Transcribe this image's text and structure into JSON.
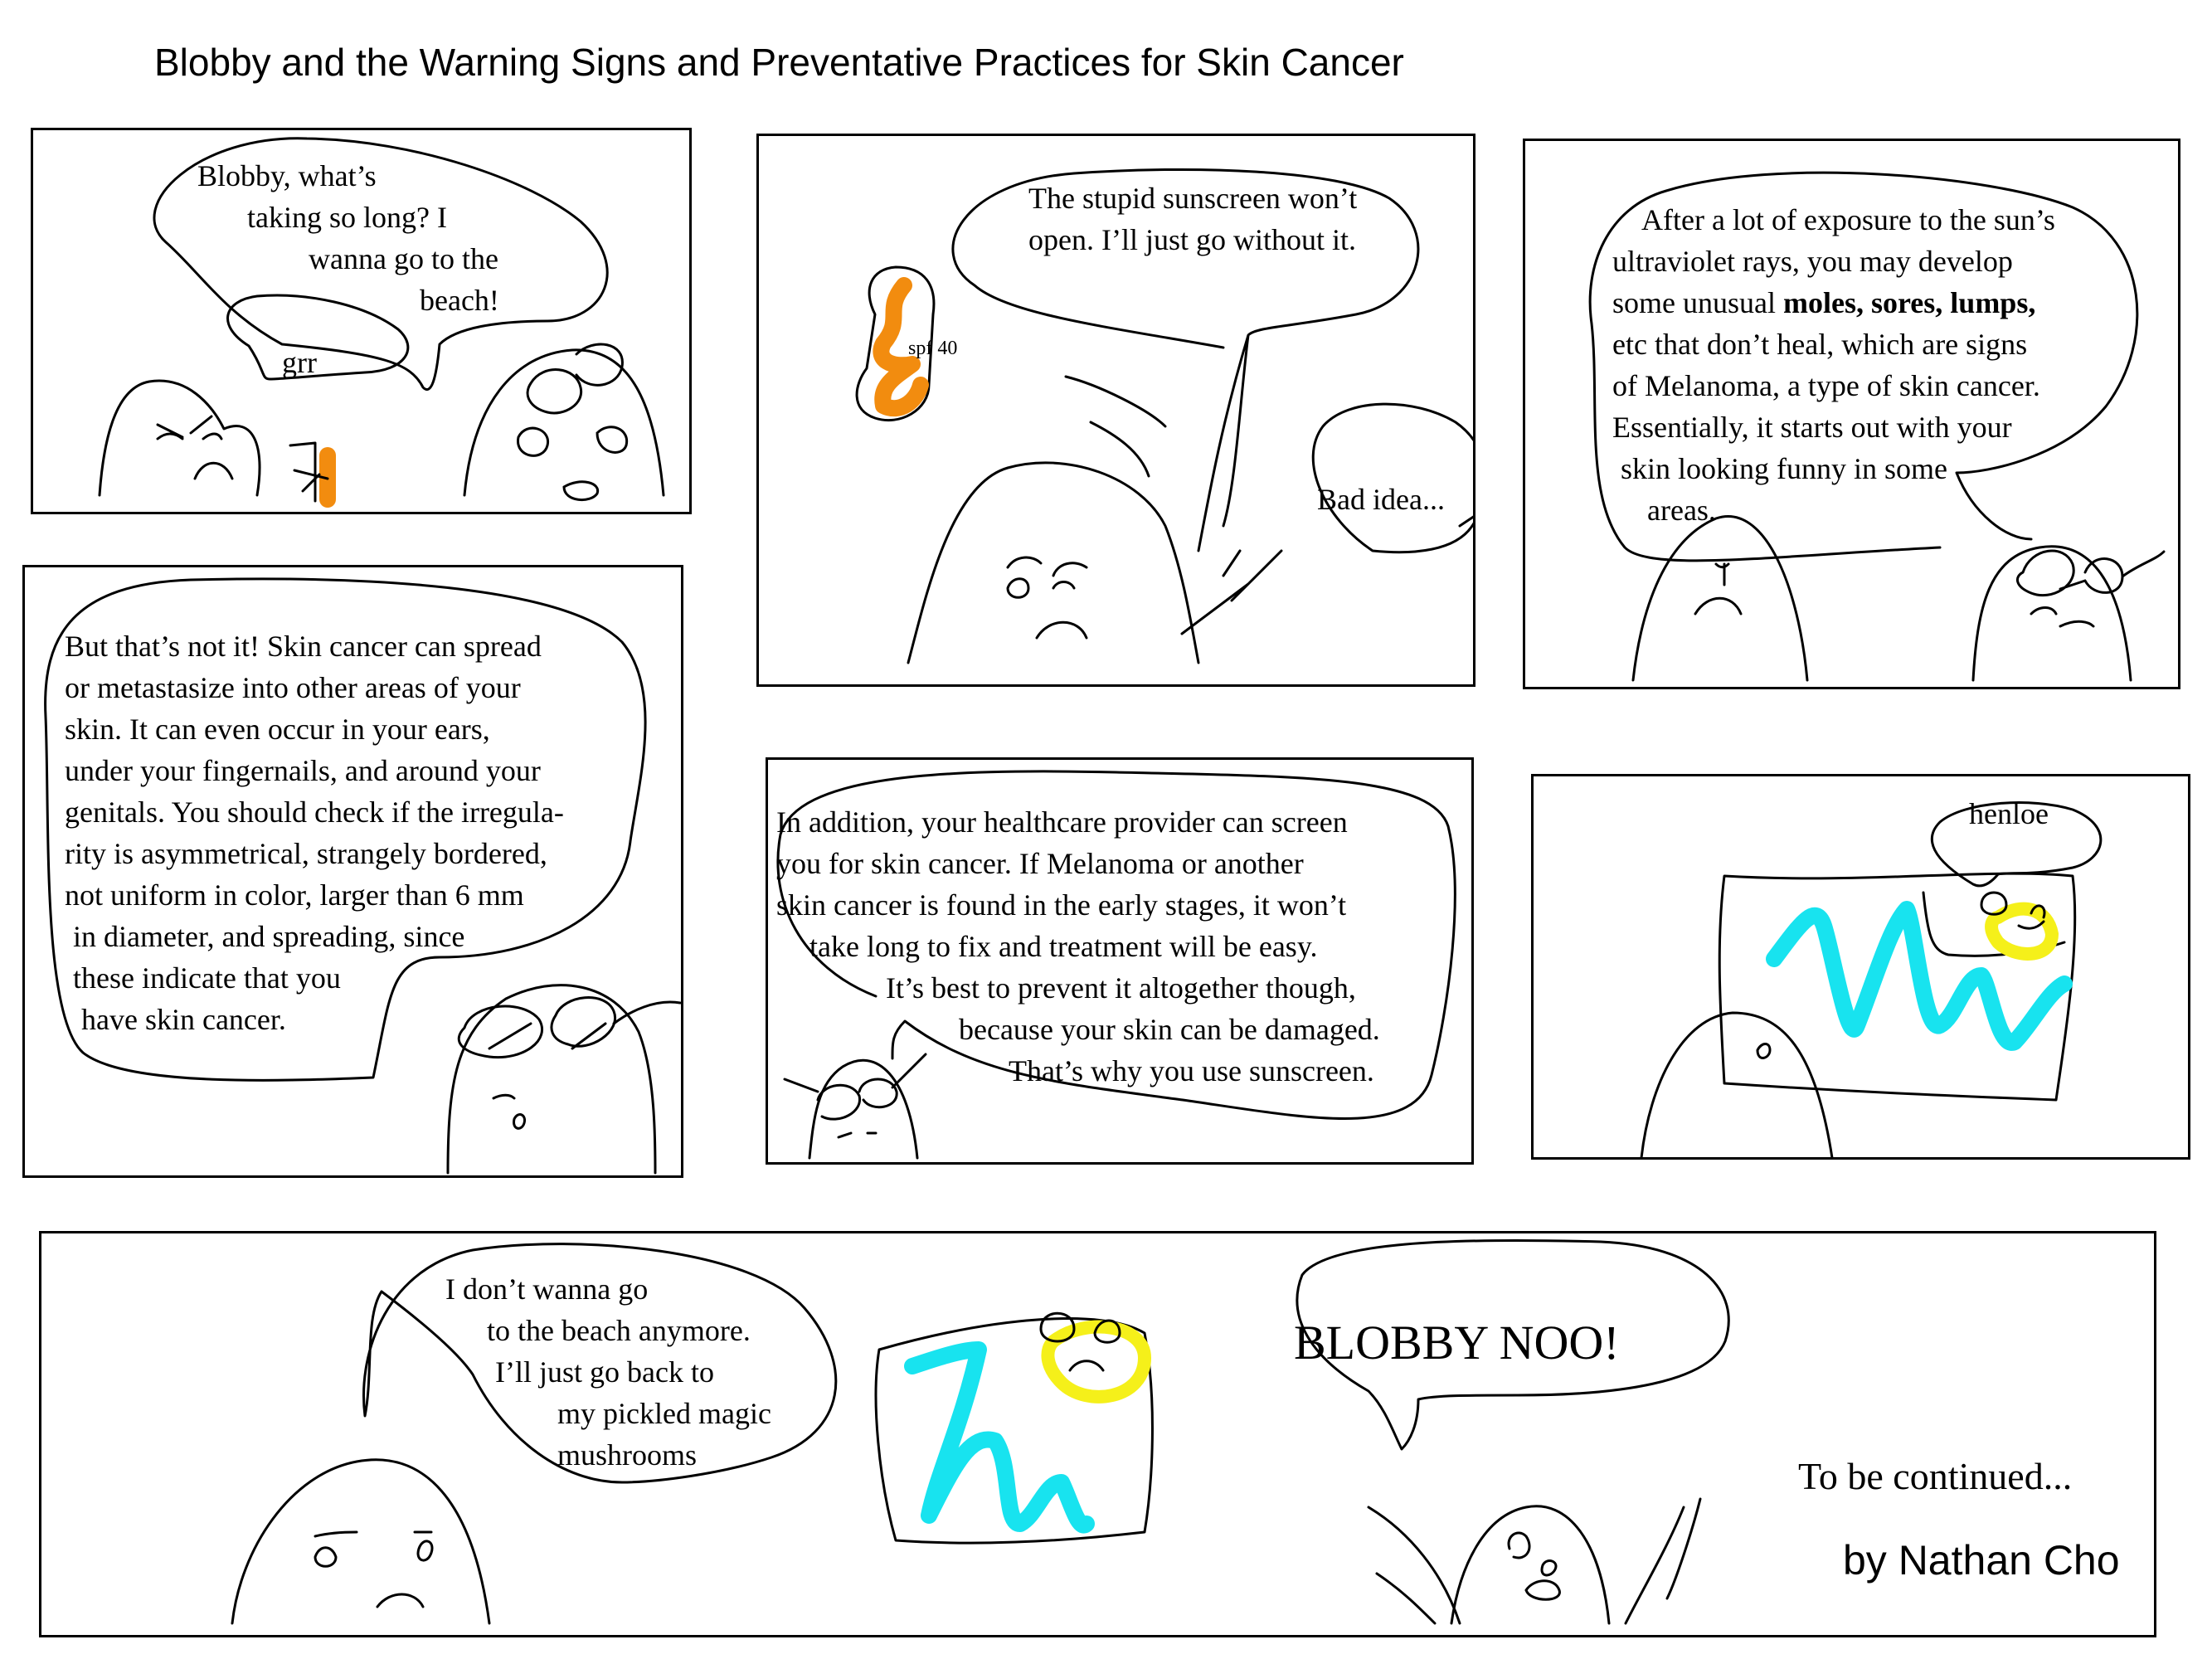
{
  "title": "Blobby and the Warning Signs and Preventative Practices for Skin Cancer",
  "colors": {
    "sunscreen": "#f28c0f",
    "sea": "#18e3ef",
    "sun": "#f5f01a",
    "ink": "#000000"
  },
  "panels": {
    "p1": {
      "speech_lines": [
        "Blobby, what’s",
        "taking so long? I",
        "wanna go to the",
        "beach!"
      ],
      "growl": "grr"
    },
    "p2": {
      "speech_lines": [
        "The stupid sunscreen won’t",
        "open. I’ll just go without it."
      ],
      "bottle_label": "spf 40",
      "reply": "Bad idea..."
    },
    "p3": {
      "speech_lines": [
        "After a lot of exposure to the sun’s",
        "ultraviolet rays, you may develop",
        "some unusual ",
        "etc that don’t heal, which are signs",
        "of Melanoma, a type of skin cancer.",
        "Essentially, it starts out with your",
        "skin looking funny in some",
        "areas."
      ],
      "bold_terms": "moles, sores, lumps,"
    },
    "p4": {
      "speech_lines": [
        "But that’s not it! Skin cancer can spread",
        "or metastasize into other areas of your",
        "skin. It can even occur in your ears,",
        "under your fingernails, and around your",
        "genitals. You should check if the irregula-",
        "rity is asymmetrical, strangely bordered,",
        "not uniform in color, larger than 6 mm",
        "in diameter, and spreading, since",
        "these indicate that you",
        "have skin cancer."
      ]
    },
    "p5": {
      "speech_lines": [
        "In addition, your healthcare provider can screen",
        "you for skin cancer. If Melanoma or another",
        "skin cancer is found in the early stages, it won’t",
        "take long to fix and treatment will be easy.",
        "It’s best to prevent it altogether though,",
        "because your skin can be damaged.",
        "That’s why you use sunscreen."
      ]
    },
    "p6": {
      "greeting": "henloe"
    },
    "p7": {
      "speech_lines": [
        "I don’t wanna go",
        "to the beach anymore.",
        "I’ll just go back to",
        "my pickled magic",
        "mushrooms"
      ],
      "shout": "BLOBBY NOO!",
      "continued": "To be continued...",
      "credit": "by Nathan Cho"
    }
  }
}
